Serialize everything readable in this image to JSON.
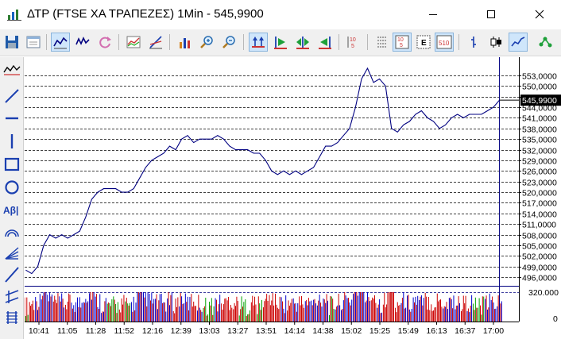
{
  "window": {
    "title": "ΔΤΡ (FTSE ΧΑ ΤΡΑΠΕΖΕΣ) 1Min - 545,9900"
  },
  "toolbar": {
    "buttons": [
      "save-icon",
      "template-icon",
      "line-chart-icon",
      "ohlc-icon",
      "refresh-icon",
      "indicator-icon",
      "study-icon",
      "volume-icon",
      "zoom-in-icon",
      "zoom-out-icon",
      "fit-all-icon",
      "go-start-icon",
      "center-icon",
      "go-end-icon",
      "prices-icon",
      "depth-10-icon",
      "depth-e-icon",
      "depth-510-icon",
      "bar-chart-icon",
      "candle-chart-icon",
      "line-style-icon",
      "connect-icon"
    ]
  },
  "sidebar": {
    "tools": [
      "indicator-icon",
      "trend-line-icon",
      "horizontal-line-icon",
      "vertical-line-icon",
      "rectangle-icon",
      "ellipse-icon",
      "text-tool-icon",
      "arc-icon",
      "fan-icon",
      "ray-icon",
      "channel-icon",
      "fibonacci-icon"
    ],
    "text_tool_label": "Αβ|"
  },
  "colors": {
    "price_line": "#000080",
    "volume_up": "#0000cc",
    "volume_down": "#cc0000",
    "volume_neutral": "#00a000",
    "grid": "#000000",
    "current_price_bg": "#000000",
    "current_price_text": "#ffffff"
  },
  "chart_data": {
    "type": "line",
    "price_axis_labels": [
      "553,0000",
      "550,0000",
      "547,0000",
      "544,0000",
      "541,0000",
      "538,0000",
      "535,0000",
      "532,0000",
      "529,0000",
      "526,0000",
      "523,0000",
      "520,0000",
      "517,0000",
      "514,0000",
      "511,0000",
      "508,0000",
      "505,0000",
      "502,0000",
      "499,0000",
      "496,0000"
    ],
    "current_price": "545,9900",
    "volume_axis_labels": [
      "320.000",
      "0"
    ],
    "volume_max": 320000,
    "x_tick_labels": [
      "10:41",
      "11:05",
      "11:28",
      "11:52",
      "12:16",
      "12:39",
      "13:03",
      "13:27",
      "13:51",
      "14:14",
      "14:38",
      "15:02",
      "15:25",
      "15:49",
      "16:13",
      "16:37",
      "17:00"
    ],
    "ylim": [
      494,
      555
    ],
    "series": [
      {
        "x": [
          "10:30",
          "10:35",
          "10:40",
          "10:45",
          "10:50",
          "10:55",
          "11:00",
          "11:05",
          "11:10",
          "11:15",
          "11:20",
          "11:25",
          "11:30",
          "11:35",
          "11:40",
          "11:45",
          "11:50",
          "11:55",
          "12:00",
          "12:05",
          "12:10",
          "12:15",
          "12:20",
          "12:25",
          "12:30",
          "12:35",
          "12:40",
          "12:45",
          "12:50",
          "12:55",
          "13:00",
          "13:05",
          "13:10",
          "13:15",
          "13:20",
          "13:25",
          "13:30",
          "13:35",
          "13:40",
          "13:45",
          "13:50",
          "13:55",
          "14:00",
          "14:05",
          "14:10",
          "14:15",
          "14:20",
          "14:25",
          "14:30",
          "14:35",
          "14:40",
          "14:45",
          "14:50",
          "14:55",
          "15:00",
          "15:05",
          "15:10",
          "15:15",
          "15:20",
          "15:25",
          "15:30",
          "15:35",
          "15:40",
          "15:45",
          "15:50",
          "15:55",
          "16:00",
          "16:05",
          "16:10",
          "16:15",
          "16:20",
          "16:25",
          "16:30",
          "16:35",
          "16:40",
          "16:45",
          "16:50",
          "16:55",
          "17:00",
          "17:05"
        ],
        "values": [
          498,
          497,
          499,
          505,
          508,
          507,
          508,
          507,
          508,
          509,
          513,
          518,
          520,
          521,
          521,
          521,
          520,
          520,
          521,
          524,
          527,
          529,
          530,
          531,
          533,
          532,
          535,
          536,
          534,
          535,
          535,
          535,
          536,
          535,
          533,
          532,
          532,
          532,
          531,
          531,
          529,
          526,
          525,
          526,
          525,
          526,
          525,
          526,
          527,
          530,
          533,
          533,
          534,
          536,
          538,
          544,
          552,
          555,
          551,
          552,
          550,
          538,
          537,
          539,
          540,
          542,
          543,
          541,
          540,
          538,
          539,
          541,
          542,
          541,
          542,
          542,
          542,
          543,
          544,
          545.99
        ]
      }
    ]
  }
}
